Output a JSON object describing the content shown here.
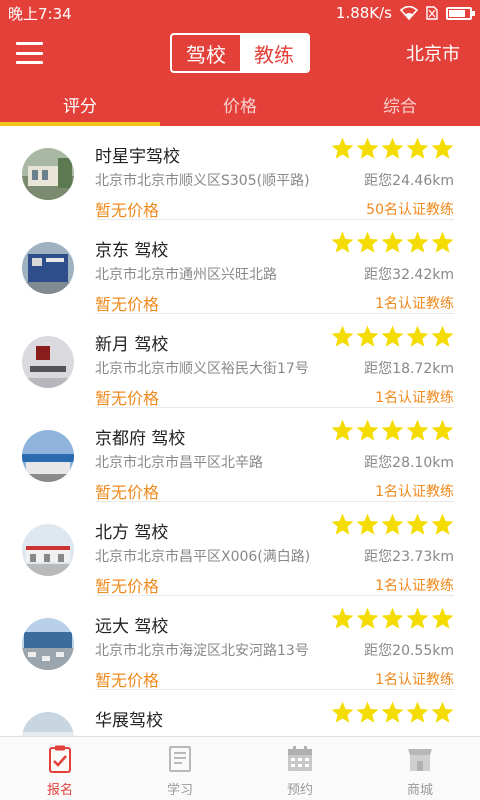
{
  "status_bar": {
    "time": "晚上7:34",
    "speed": "1.88K/s",
    "battery_level": 0.8
  },
  "header": {
    "segment_left": "驾校",
    "segment_right": "教练",
    "city": "北京市"
  },
  "tabs": [
    {
      "label": "评分",
      "active": true
    },
    {
      "label": "价格",
      "active": false
    },
    {
      "label": "综合",
      "active": false
    }
  ],
  "colors": {
    "primary_red": "#e4403a",
    "star_yellow": "#f5dc00",
    "orange": "#f08a1e"
  },
  "schools": [
    {
      "name": "时星宇驾校",
      "address": "北京市北京市顺义区S305(顺平路)",
      "distance": "距您24.46km",
      "price": "暂无价格",
      "coaches": "50名认证教练",
      "rating": 5
    },
    {
      "name": "京东 驾校",
      "address": "北京市北京市通州区兴旺北路",
      "distance": "距您32.42km",
      "price": "暂无价格",
      "coaches": "1名认证教练",
      "rating": 5
    },
    {
      "name": "新月 驾校",
      "address": "北京市北京市顺义区裕民大街17号",
      "distance": "距您18.72km",
      "price": "暂无价格",
      "coaches": "1名认证教练",
      "rating": 5
    },
    {
      "name": "京都府 驾校",
      "address": "北京市北京市昌平区北辛路",
      "distance": "距您28.10km",
      "price": "暂无价格",
      "coaches": "1名认证教练",
      "rating": 5
    },
    {
      "name": "北方 驾校",
      "address": "北京市北京市昌平区X006(满白路)",
      "distance": "距您23.73km",
      "price": "暂无价格",
      "coaches": "1名认证教练",
      "rating": 5
    },
    {
      "name": "远大 驾校",
      "address": "北京市北京市海淀区北安河路13号",
      "distance": "距您20.55km",
      "price": "暂无价格",
      "coaches": "1名认证教练",
      "rating": 5
    },
    {
      "name": "华展驾校",
      "address": "",
      "distance": "",
      "price": "",
      "coaches": "",
      "rating": 5
    }
  ],
  "bottom_nav": [
    {
      "label": "报名",
      "icon": "clipboard-check-icon",
      "active": true
    },
    {
      "label": "学习",
      "icon": "book-icon",
      "active": false
    },
    {
      "label": "预约",
      "icon": "calendar-icon",
      "active": false
    },
    {
      "label": "商城",
      "icon": "shop-icon",
      "active": false
    }
  ]
}
